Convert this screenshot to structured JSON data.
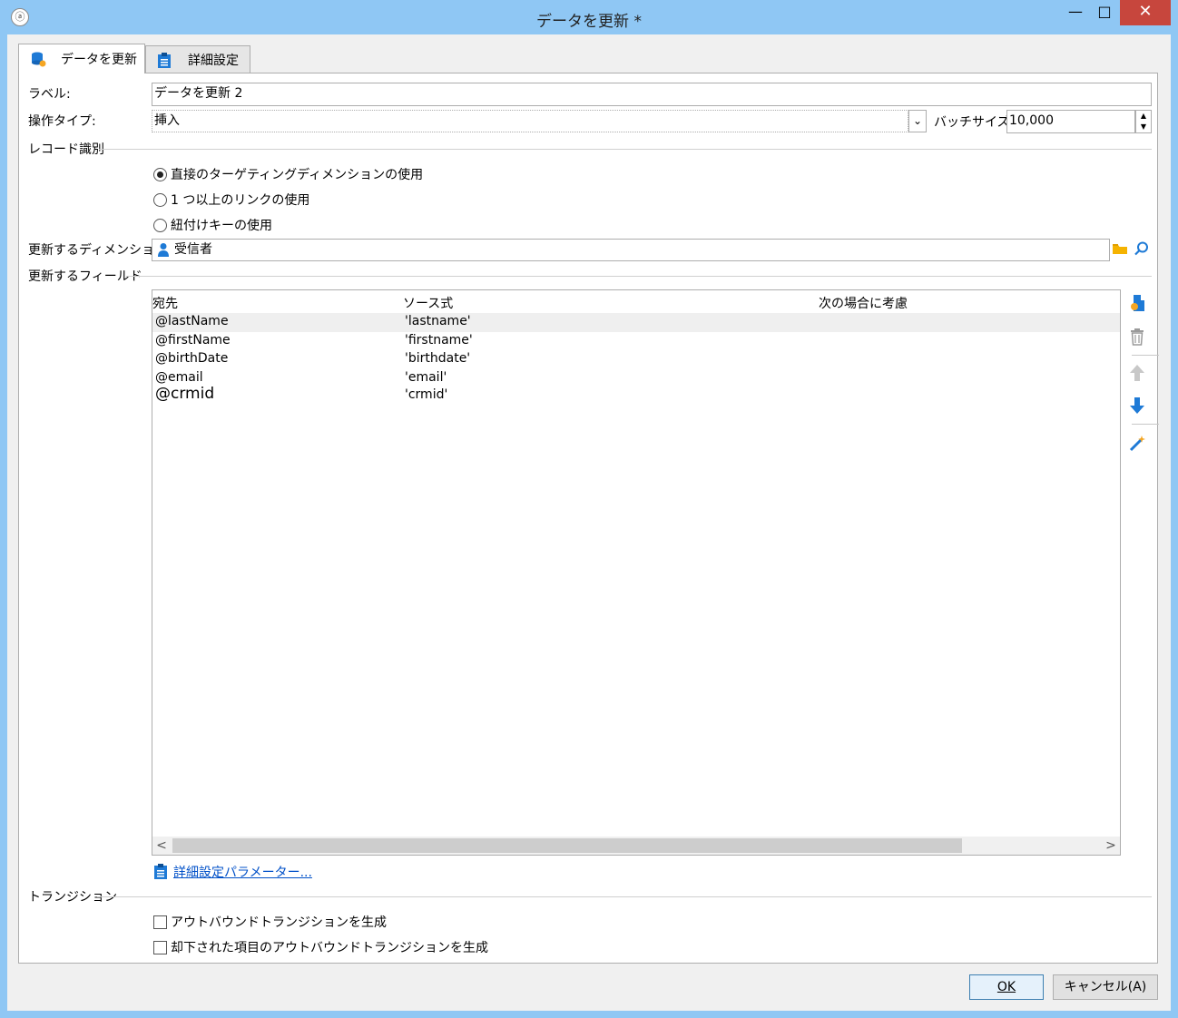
{
  "window": {
    "title": "データを更新 *",
    "minimize": "—",
    "maximize": "□",
    "close": "✕"
  },
  "tabs": [
    {
      "label": "データを更新",
      "icon": "database-refresh-icon"
    },
    {
      "label": "詳細設定",
      "icon": "clipboard-icon"
    }
  ],
  "form": {
    "label_caption": "ラベル:",
    "label_value": "データを更新 2",
    "operation_caption": "操作タイプ:",
    "operation_value": "挿入",
    "batch_caption": "バッチサイズ:",
    "batch_value": "10,000"
  },
  "record_identification": {
    "heading": "レコード識別",
    "options": [
      {
        "label": "直接のターゲティングディメンションの使用",
        "selected": true
      },
      {
        "label": "1 つ以上のリンクの使用",
        "selected": false
      },
      {
        "label": "紐付けキーの使用",
        "selected": false
      }
    ]
  },
  "dimension": {
    "caption": "更新するディメンション:",
    "value": "受信者"
  },
  "fields": {
    "heading": "更新するフィールド",
    "columns": [
      "宛先",
      "ソース式",
      "次の場合に考慮"
    ],
    "rows": [
      {
        "dest": "@lastName",
        "source": "'lastname'",
        "when": ""
      },
      {
        "dest": "@firstName",
        "source": "'firstname'",
        "when": ""
      },
      {
        "dest": "@birthDate",
        "source": "'birthdate'",
        "when": ""
      },
      {
        "dest": "@email",
        "source": "'email'",
        "when": ""
      },
      {
        "dest": "@crmid",
        "source": "'crmid'",
        "when": ""
      }
    ]
  },
  "advanced_link": "詳細設定パラメーター...",
  "transition": {
    "heading": "トランジション",
    "options": [
      {
        "label": "アウトバウンドトランジションを生成",
        "checked": false
      },
      {
        "label": "却下された項目のアウトバウンドトランジションを生成",
        "checked": false
      }
    ]
  },
  "buttons": {
    "ok": "OK",
    "cancel": "キャンセル(A)"
  },
  "colors": {
    "titlebar": "#8fc7f4",
    "close": "#c7463d",
    "link": "#0050c8",
    "accent_icon": "#1e7ad6"
  }
}
